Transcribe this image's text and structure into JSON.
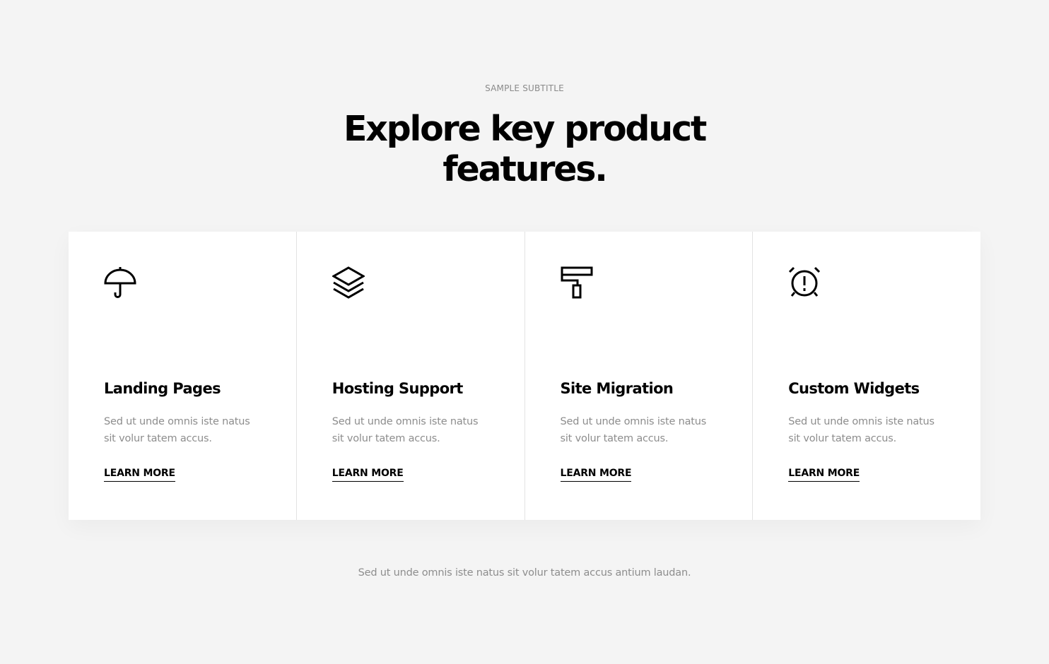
{
  "header": {
    "subtitle": "SAMPLE SUBTITLE",
    "title_line1": "Explore key product",
    "title_line2": "features."
  },
  "features": [
    {
      "icon": "umbrella-icon",
      "title": "Landing Pages",
      "text_line1": "Sed ut unde omnis iste natus",
      "text_line2": "sit volur tatem accus.",
      "link": "LEARN MORE"
    },
    {
      "icon": "layers-icon",
      "title": "Hosting Support",
      "text_line1": "Sed ut unde omnis iste natus",
      "text_line2": "sit volur tatem accus.",
      "link": "LEARN MORE"
    },
    {
      "icon": "paint-roller-icon",
      "title": "Site Migration",
      "text_line1": "Sed ut unde omnis iste natus",
      "text_line2": "sit volur tatem accus.",
      "link": "LEARN MORE"
    },
    {
      "icon": "alarm-clock-icon",
      "title": "Custom Widgets",
      "text_line1": "Sed ut unde omnis iste natus",
      "text_line2": "sit volur tatem accus.",
      "link": "LEARN MORE"
    }
  ],
  "footer": {
    "note": "Sed ut unde omnis iste natus sit volur tatem accus antium laudan."
  },
  "colors": {
    "background": "#f4f4f4",
    "card_background": "#ffffff",
    "text_primary": "#000000",
    "text_muted": "#8d8d8d",
    "divider": "#e2e2e2"
  }
}
